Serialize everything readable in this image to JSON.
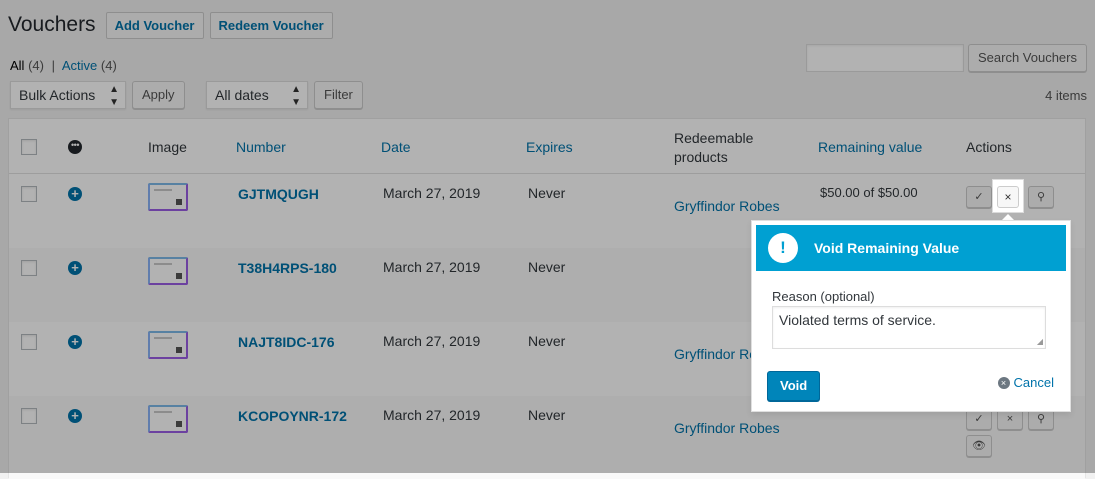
{
  "header": {
    "title": "Vouchers",
    "add_label": "Add Voucher",
    "redeem_label": "Redeem Voucher"
  },
  "views": {
    "all_label": "All",
    "all_count": "(4)",
    "sep": "|",
    "active_label": "Active",
    "active_count": "(4)"
  },
  "search": {
    "value": "",
    "button_label": "Search Vouchers"
  },
  "tablenav": {
    "bulk_actions": "Bulk Actions",
    "apply_label": "Apply",
    "dates": "All dates",
    "filter_label": "Filter",
    "items_count": "4 items"
  },
  "columns": {
    "image": "Image",
    "number": "Number",
    "date": "Date",
    "expires": "Expires",
    "redeemable_line1": "Redeemable",
    "redeemable_line2": "products",
    "remaining": "Remaining value",
    "actions": "Actions"
  },
  "rows": [
    {
      "number": "GJTMQUGH",
      "date": "March 27, 2019",
      "expires": "Never",
      "product": "Gryffindor Robes",
      "remaining": "$50.00 of $50.00"
    },
    {
      "number": "T38H4RPS-180",
      "date": "March 27, 2019",
      "expires": "Never",
      "product": "",
      "remaining": ""
    },
    {
      "number": "NAJT8IDC-176",
      "date": "March 27, 2019",
      "expires": "Never",
      "product": "Gryffindor Ro",
      "remaining": ""
    },
    {
      "number": "KCOPOYNR-172",
      "date": "March 27, 2019",
      "expires": "Never",
      "product": "Gryffindor Robes",
      "remaining": ""
    }
  ],
  "icons": {
    "check": "✓",
    "close": "×",
    "pin": "⚲",
    "eye": "👁",
    "plus": "+",
    "dots": "•••"
  },
  "modal": {
    "title": "Void Remaining Value",
    "alert_glyph": "!",
    "reason_label": "Reason (optional)",
    "reason_value": "Violated terms of service.",
    "void_label": "Void",
    "cancel_label": "Cancel"
  },
  "colors": {
    "accent": "#0073aa",
    "modal_header": "#00a0d2",
    "primary_button": "#0085ba"
  }
}
